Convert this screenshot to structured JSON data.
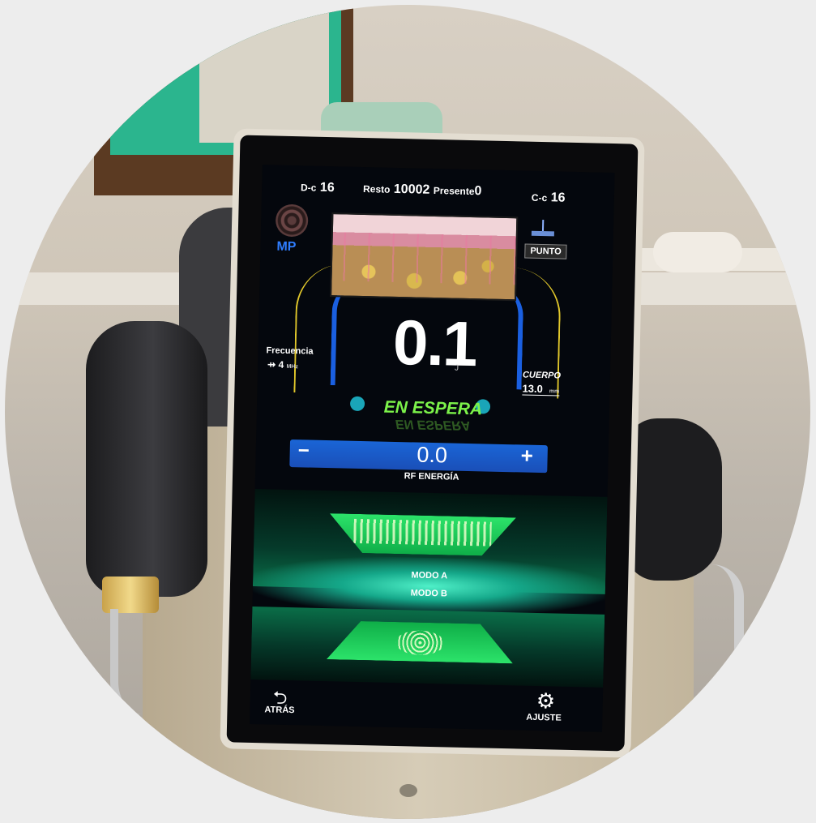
{
  "topbar": {
    "dc_label": "D-c",
    "dc_value": "16",
    "resto_label": "Resto",
    "resto_value": "10002",
    "presente_label": "Presente",
    "presente_value": "0",
    "cc_label": "C-c",
    "cc_value": "16"
  },
  "left_panel": {
    "mode_label": "MP",
    "frequency_label": "Frecuencia",
    "frequency_value": "4",
    "frequency_unit": "MHz"
  },
  "right_panel": {
    "point_label": "PUNTO",
    "depth_label": "CUERPO",
    "depth_value": "13.0",
    "depth_unit": "mm"
  },
  "energy": {
    "value": "0.1",
    "unit": "J"
  },
  "status": {
    "text": "EN ESPERA"
  },
  "rf": {
    "minus": "−",
    "value": "0.0",
    "plus": "+",
    "label": "RF ENERGÍA"
  },
  "modes": {
    "mode_a": "MODO A",
    "mode_b": "MODO B"
  },
  "footer": {
    "back_label": "ATRÁS",
    "settings_label": "AJUSTE"
  },
  "icons": {
    "back": "back-arrow-icon",
    "settings": "gear-icon",
    "mode": "spiral-icon",
    "point": "point-icon"
  },
  "colors": {
    "accent_blue": "#1a5fe0",
    "status_green": "#7cf24a",
    "accent_yellow": "#e1c72b"
  }
}
